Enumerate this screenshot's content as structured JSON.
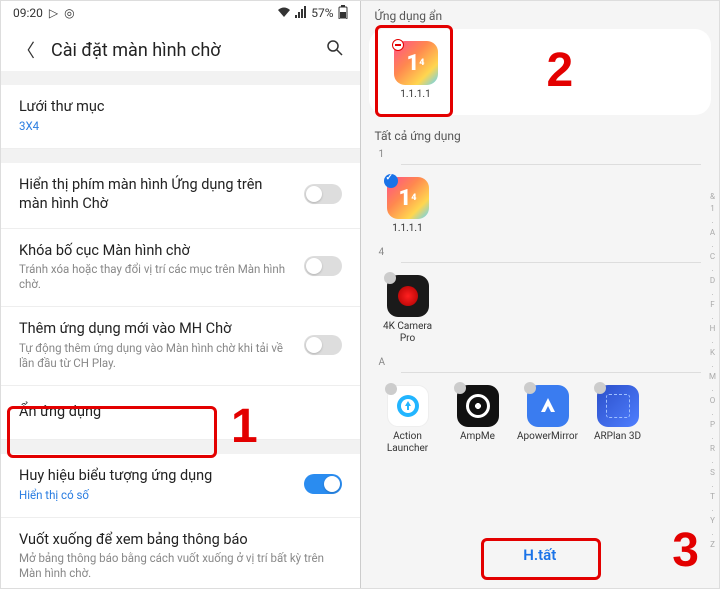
{
  "status": {
    "time": "09:20",
    "battery": "57%"
  },
  "left": {
    "title": "Cài đặt màn hình chờ",
    "grid": {
      "label": "Lưới thư mục",
      "value": "3X4"
    },
    "items": {
      "showApps": {
        "label": "Hiển thị phím màn hình Ứng dụng trên màn hình Chờ"
      },
      "lock": {
        "label": "Khóa bố cục Màn hình chờ",
        "sub": "Tránh xóa hoặc thay đổi vị trí các mục trên Màn hình chờ."
      },
      "addApps": {
        "label": "Thêm ứng dụng mới vào MH Chờ",
        "sub": "Tự động thêm ứng dụng vào Màn hình chờ khi tải về lần đầu từ CH Play."
      },
      "hide": {
        "label": "Ẩn ứng dụng"
      },
      "badges": {
        "label": "Huy hiệu biểu tượng ứng dụng",
        "sub": "Hiển thị có số"
      },
      "swipe": {
        "label": "Vuốt xuống để xem bảng thông báo",
        "sub": "Mở bảng thông báo bằng cách vuốt xuống ở vị trí bất kỳ trên Màn hình chờ."
      }
    }
  },
  "right": {
    "hiddenTitle": "Ứng dụng ẩn",
    "allTitle": "Tất cả ứng dụng",
    "indexes": {
      "one": "1",
      "four": "4",
      "A": "A"
    },
    "apps": {
      "h1111": "1.1.1.1",
      "a1111": "1.1.1.1",
      "cam4k": "4K Camera Pro",
      "action": "Action Launcher",
      "ampme": "AmpMe",
      "apower": "ApowerMirror",
      "arplan": "ARPlan 3D"
    },
    "azIndex": "&\n1\n.\nA\n.\nC\n.\nD\n.\nF\n.\nH\n.\nK\n.\nM\n.\nO\n.\nP\n.\nR\n.\nS\n.\nT\n.\nY\n.\nZ",
    "done": "H.tất"
  },
  "annotations": {
    "n1": "1",
    "n2": "2",
    "n3": "3"
  }
}
